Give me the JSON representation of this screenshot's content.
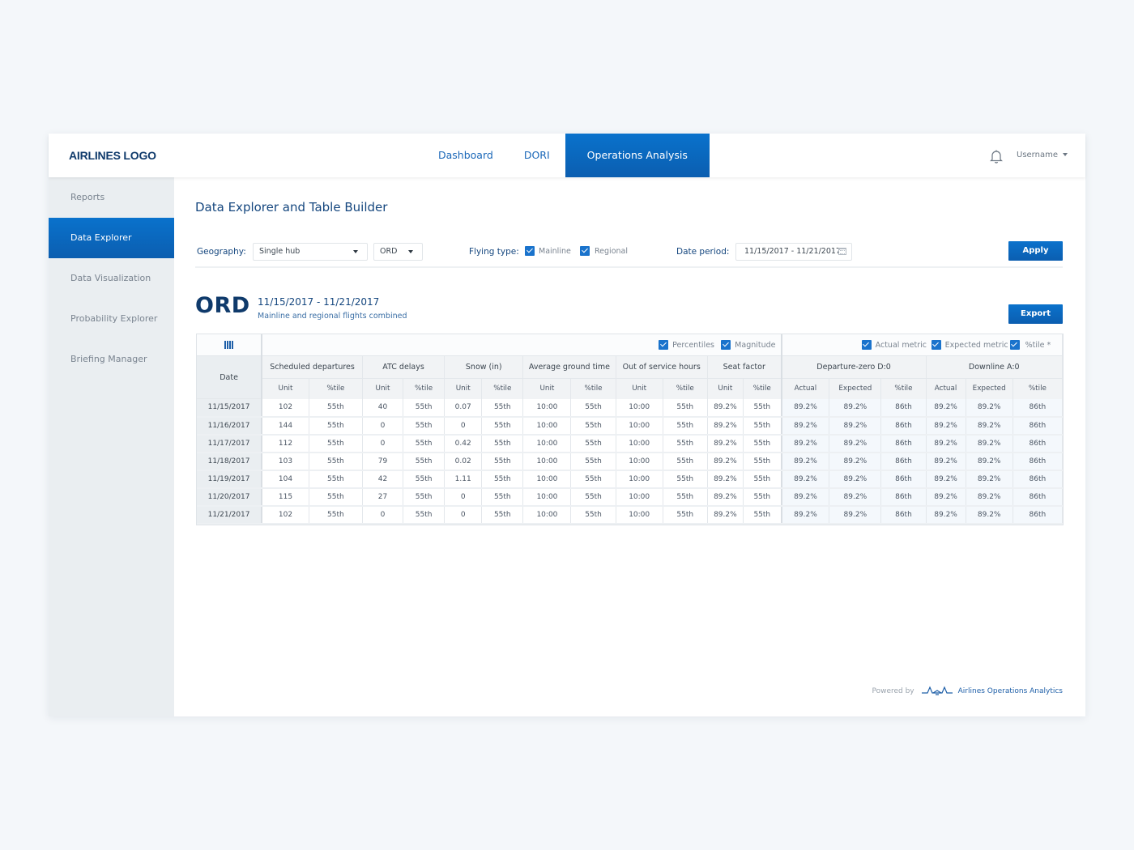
{
  "header": {
    "logo": "AIRLINES LOGO",
    "nav": [
      {
        "label": "Dashboard",
        "active": false
      },
      {
        "label": "DORI",
        "active": false
      },
      {
        "label": "Operations Analysis",
        "active": true
      }
    ],
    "username": "Username"
  },
  "sidebar": {
    "items": [
      {
        "label": "Reports",
        "active": false
      },
      {
        "label": "Data Explorer",
        "active": true
      },
      {
        "label": "Data Visualization",
        "active": false
      },
      {
        "label": "Probability Explorer",
        "active": false
      },
      {
        "label": "Briefing Manager",
        "active": false
      }
    ]
  },
  "page": {
    "title": "Data Explorer and Table Builder"
  },
  "filters": {
    "geography_label": "Geography:",
    "geography_value": "Single hub",
    "hub_value": "ORD",
    "flying_type_label": "Flying type:",
    "mainline_label": "Mainline",
    "mainline_checked": true,
    "regional_label": "Regional",
    "regional_checked": true,
    "date_period_label": "Date period:",
    "date_period_value": "11/15/2017 - 11/21/2017",
    "apply_label": "Apply"
  },
  "result": {
    "hub": "ORD",
    "range": "11/15/2017 - 11/21/2017",
    "subtitle": "Mainline  and regional flights combined",
    "export_label": "Export"
  },
  "table": {
    "toolbar_left": [
      {
        "label": "Percentiles",
        "checked": true
      },
      {
        "label": "Magnitude",
        "checked": true
      }
    ],
    "toolbar_right": [
      {
        "label": "Actual metric",
        "checked": true
      },
      {
        "label": "Expected metric",
        "checked": true
      },
      {
        "label": "%tile *",
        "checked": true
      }
    ],
    "date_header": "Date",
    "groups": [
      {
        "label": "Scheduled departures",
        "subs": [
          "Unit",
          "%tile"
        ]
      },
      {
        "label": "ATC delays",
        "subs": [
          "Unit",
          "%tile"
        ]
      },
      {
        "label": "Snow (in)",
        "subs": [
          "Unit",
          "%tile"
        ]
      },
      {
        "label": "Average ground time",
        "subs": [
          "Unit",
          "%tile"
        ]
      },
      {
        "label": "Out of service hours",
        "subs": [
          "Unit",
          "%tile"
        ]
      },
      {
        "label": "Seat factor",
        "subs": [
          "Unit",
          "%tile"
        ]
      },
      {
        "label": "Departure-zero D:0",
        "subs": [
          "Actual",
          "Expected",
          "%tile"
        ]
      },
      {
        "label": "Downline A:0",
        "subs": [
          "Actual",
          "Expected",
          "%tile"
        ]
      }
    ],
    "rows": [
      [
        "11/15/2017",
        "102",
        "55th",
        "40",
        "55th",
        "0.07",
        "55th",
        "10:00",
        "55th",
        "10:00",
        "55th",
        "89.2%",
        "55th",
        "89.2%",
        "89.2%",
        "86th",
        "89.2%",
        "89.2%",
        "86th"
      ],
      [
        "11/16/2017",
        "144",
        "55th",
        "0",
        "55th",
        "0",
        "55th",
        "10:00",
        "55th",
        "10:00",
        "55th",
        "89.2%",
        "55th",
        "89.2%",
        "89.2%",
        "86th",
        "89.2%",
        "89.2%",
        "86th"
      ],
      [
        "11/17/2017",
        "112",
        "55th",
        "0",
        "55th",
        "0.42",
        "55th",
        "10:00",
        "55th",
        "10:00",
        "55th",
        "89.2%",
        "55th",
        "89.2%",
        "89.2%",
        "86th",
        "89.2%",
        "89.2%",
        "86th"
      ],
      [
        "11/18/2017",
        "103",
        "55th",
        "79",
        "55th",
        "0.02",
        "55th",
        "10:00",
        "55th",
        "10:00",
        "55th",
        "89.2%",
        "55th",
        "89.2%",
        "89.2%",
        "86th",
        "89.2%",
        "89.2%",
        "86th"
      ],
      [
        "11/19/2017",
        "104",
        "55th",
        "42",
        "55th",
        "1.11",
        "55th",
        "10:00",
        "55th",
        "10:00",
        "55th",
        "89.2%",
        "55th",
        "89.2%",
        "89.2%",
        "86th",
        "89.2%",
        "89.2%",
        "86th"
      ],
      [
        "11/20/2017",
        "115",
        "55th",
        "27",
        "55th",
        "0",
        "55th",
        "10:00",
        "55th",
        "10:00",
        "55th",
        "89.2%",
        "55th",
        "89.2%",
        "89.2%",
        "86th",
        "89.2%",
        "89.2%",
        "86th"
      ],
      [
        "11/21/2017",
        "102",
        "55th",
        "0",
        "55th",
        "0",
        "55th",
        "10:00",
        "55th",
        "10:00",
        "55th",
        "89.2%",
        "55th",
        "89.2%",
        "89.2%",
        "86th",
        "89.2%",
        "89.2%",
        "86th"
      ]
    ]
  },
  "footer": {
    "powered_by": "Powered by",
    "brand": "Airlines Operations Analytics"
  },
  "colors": {
    "primary": "#0b67c0",
    "navy": "#0f3a6b",
    "sidebar_bg": "#eaeef1"
  }
}
